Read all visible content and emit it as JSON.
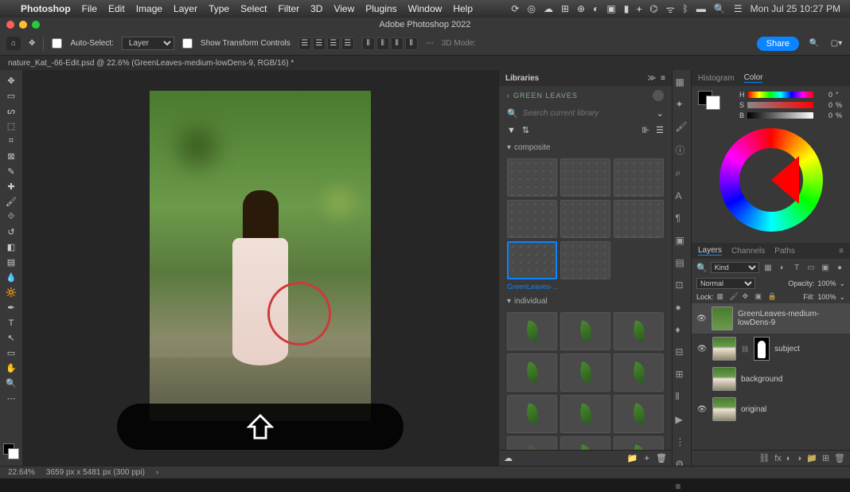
{
  "menubar": {
    "app": "Photoshop",
    "items": [
      "File",
      "Edit",
      "Image",
      "Layer",
      "Type",
      "Select",
      "Filter",
      "3D",
      "View",
      "Plugins",
      "Window",
      "Help"
    ],
    "datetime": "Mon Jul 25  10:27 PM"
  },
  "window_title": "Adobe Photoshop 2022",
  "options": {
    "auto_select_label": "Auto-Select:",
    "auto_select_target": "Layer",
    "show_transform_label": "Show Transform Controls",
    "mode_3d_label": "3D Mode:",
    "share_label": "Share"
  },
  "document_tab": "nature_Kat_-66-Edit.psd @ 22.6% (GreenLeaves-medium-lowDens-9, RGB/16) *",
  "libraries": {
    "panel_title": "Libraries",
    "breadcrumb": "GREEN LEAVES",
    "search_placeholder": "Search current library",
    "sections": {
      "composite": "composite",
      "individual": "individual"
    },
    "selected_thumb": "GreenLeaves-..."
  },
  "color_panel": {
    "tabs": {
      "histogram": "Histogram",
      "color": "Color"
    },
    "hsb": {
      "h_label": "H",
      "s_label": "S",
      "b_label": "B",
      "h": "0",
      "s": "0",
      "b": "0",
      "deg": "°",
      "pct": "%"
    }
  },
  "layers_panel": {
    "tabs": {
      "layers": "Layers",
      "channels": "Channels",
      "paths": "Paths"
    },
    "filter_kind": "Kind",
    "blend_mode": "Normal",
    "opacity_label": "Opacity:",
    "opacity_value": "100%",
    "lock_label": "Lock:",
    "fill_label": "Fill:",
    "fill_value": "100%",
    "layers": [
      {
        "name": "GreenLeaves-medium-lowDens-9",
        "selected": true,
        "thumb": "leaves",
        "mask": false
      },
      {
        "name": "subject",
        "selected": false,
        "thumb": "photo",
        "mask": true
      },
      {
        "name": "background",
        "selected": false,
        "thumb": "photo",
        "mask": false
      },
      {
        "name": "original",
        "selected": false,
        "thumb": "photo",
        "mask": false
      }
    ]
  },
  "status": {
    "zoom": "22.64%",
    "doc_dims": "3659 px x 5481 px (300 ppi)"
  }
}
